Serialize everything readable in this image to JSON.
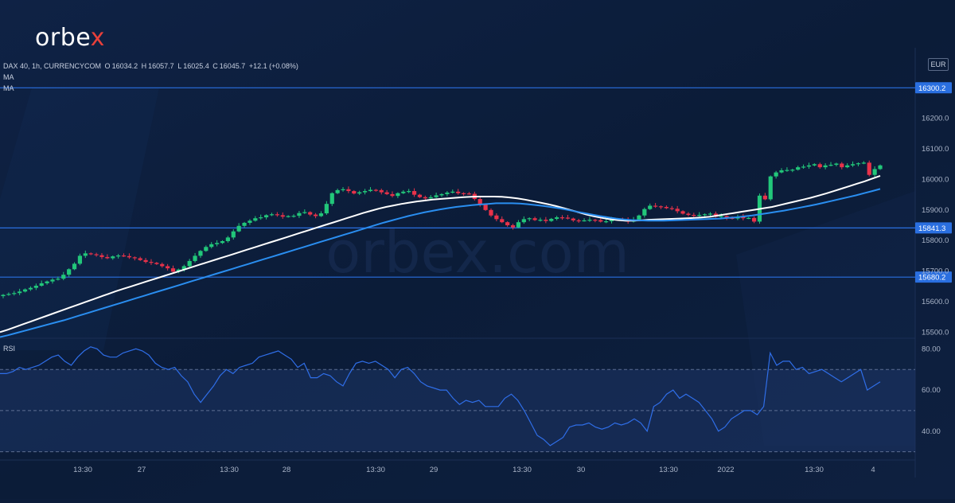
{
  "brand": {
    "logo_text": "orbe",
    "logo_accent": "x",
    "watermark": "orbex.com"
  },
  "header": {
    "symbol": "DAX 40, 1h, CURRENCYCOM",
    "open_label": "O",
    "open": "16034.2",
    "high_label": "H",
    "high": "16057.7",
    "low_label": "L",
    "low": "16025.4",
    "close_label": "C",
    "close": "16045.7",
    "change": "+12.1 (+0.08%)",
    "indicator_1": "MA",
    "indicator_2": "MA"
  },
  "axis": {
    "currency": "EUR"
  },
  "rsi": {
    "label": "RSI"
  },
  "colors": {
    "background": "#0c1d3a",
    "up": "#22c77a",
    "down": "#e8324a",
    "ma_fast": "#ffffff",
    "ma_slow": "#2a8ef0",
    "level": "#2a6fe0",
    "rsi_line": "#2f6ee8"
  },
  "chart_data": [
    {
      "type": "candlestick",
      "title": "DAX 40, 1h, CURRENCYCOM",
      "ylim": [
        15480,
        16400
      ],
      "y_ticks": [
        15500.0,
        15600.0,
        15700.0,
        15800.0,
        15900.0,
        16000.0,
        16100.0,
        16200.0
      ],
      "y_tick_labels": [
        "15500.0",
        "15600.0",
        "15700.0",
        "15800.0",
        "15900.0",
        "16000.0",
        "16100.0",
        "16200.0"
      ],
      "x_tick_labels": [
        "13:30",
        "27",
        "13:30",
        "28",
        "13:30",
        "29",
        "13:30",
        "30",
        "13:30",
        "2022",
        "13:30",
        "4"
      ],
      "levels": [
        16300.2,
        15841.3,
        15680.2
      ],
      "level_labels": [
        "16300.2",
        "15841.3",
        "15680.2"
      ],
      "close_values": [
        15622,
        15625,
        15628,
        15633,
        15640,
        15645,
        15652,
        15660,
        15666,
        15672,
        15675,
        15688,
        15706,
        15724,
        15750,
        15758,
        15755,
        15752,
        15746,
        15742,
        15748,
        15751,
        15749,
        15745,
        15742,
        15736,
        15730,
        15727,
        15723,
        15716,
        15709,
        15698,
        15705,
        15716,
        15733,
        15750,
        15766,
        15779,
        15788,
        15792,
        15798,
        15810,
        15830,
        15848,
        15858,
        15865,
        15873,
        15876,
        15883,
        15886,
        15883,
        15878,
        15880,
        15881,
        15890,
        15893,
        15885,
        15880,
        15889,
        15920,
        15955,
        15965,
        15968,
        15962,
        15954,
        15958,
        15962,
        15966,
        15965,
        15958,
        15952,
        15946,
        15955,
        15960,
        15962,
        15950,
        15942,
        15938,
        15942,
        15948,
        15952,
        15957,
        15960,
        15955,
        15954,
        15953,
        15936,
        15918,
        15900,
        15882,
        15870,
        15860,
        15850,
        15843,
        15860,
        15870,
        15873,
        15867,
        15868,
        15864,
        15871,
        15876,
        15875,
        15872,
        15866,
        15865,
        15866,
        15868,
        15867,
        15862,
        15863,
        15868,
        15870,
        15869,
        15862,
        15868,
        15882,
        15903,
        15914,
        15912,
        15910,
        15906,
        15904,
        15896,
        15888,
        15884,
        15881,
        15884,
        15886,
        15888,
        15878,
        15880,
        15874,
        15872,
        15878,
        15873,
        15874,
        15862,
        15947,
        15935,
        16010,
        16023,
        16030,
        16031,
        16032,
        16040,
        16042,
        16046,
        16050,
        16040,
        16046,
        16048,
        16052,
        16040,
        16046,
        16050,
        16053,
        16055,
        16015,
        16034,
        16046
      ],
      "series": [
        {
          "name": "MA",
          "values": [
            15500,
            15508,
            15517,
            15526,
            15535,
            15544,
            15553,
            15562,
            15571,
            15580,
            15589,
            15598,
            15607,
            15616,
            15625,
            15634,
            15642,
            15650,
            15658,
            15666,
            15674,
            15682,
            15690,
            15698,
            15706,
            15714,
            15722,
            15730,
            15738,
            15746,
            15754,
            15762,
            15770,
            15778,
            15786,
            15794,
            15802,
            15810,
            15818,
            15826,
            15834,
            15842,
            15850,
            15858,
            15866,
            15874,
            15882,
            15890,
            15897,
            15904,
            15910,
            15915,
            15920,
            15924,
            15928,
            15931,
            15934,
            15936,
            15938,
            15940,
            15942,
            15943,
            15944,
            15944,
            15944,
            15943,
            15941,
            15938,
            15934,
            15929,
            15924,
            15919,
            15913,
            15906,
            15899,
            15892,
            15885,
            15879,
            15874,
            15870,
            15867,
            15865,
            15865,
            15866,
            15868,
            15869,
            15870,
            15871,
            15872,
            15873,
            15874,
            15876,
            15878,
            15882,
            15886,
            15890,
            15894,
            15898,
            15902,
            15906,
            15910,
            15916,
            15922,
            15928,
            15934,
            15940,
            15947,
            15954,
            15962,
            15970,
            15978,
            15986,
            15994,
            16003,
            16012
          ]
        },
        {
          "name": "MA",
          "values": [
            15484,
            15490,
            15497,
            15504,
            15511,
            15518,
            15525,
            15532,
            15539,
            15547,
            15555,
            15563,
            15571,
            15579,
            15587,
            15595,
            15603,
            15611,
            15619,
            15627,
            15635,
            15643,
            15651,
            15659,
            15667,
            15675,
            15683,
            15691,
            15699,
            15707,
            15715,
            15723,
            15731,
            15739,
            15747,
            15755,
            15763,
            15771,
            15779,
            15787,
            15795,
            15803,
            15811,
            15819,
            15827,
            15835,
            15843,
            15851,
            15859,
            15866,
            15873,
            15880,
            15886,
            15892,
            15897,
            15902,
            15906,
            15910,
            15913,
            15916,
            15918,
            15920,
            15922,
            15922,
            15922,
            15921,
            15919,
            15916,
            15913,
            15909,
            15905,
            15900,
            15895,
            15890,
            15885,
            15880,
            15876,
            15872,
            15869,
            15867,
            15866,
            15865,
            15865,
            15865,
            15866,
            15867,
            15868,
            15869,
            15870,
            15871,
            15872,
            15874,
            15876,
            15879,
            15882,
            15886,
            15890,
            15894,
            15898,
            15903,
            15908,
            15913,
            15918,
            15924,
            15930,
            15936,
            15942,
            15948,
            15955,
            15962,
            15969
          ]
        }
      ]
    },
    {
      "type": "line",
      "title": "RSI",
      "ylim": [
        26,
        84
      ],
      "y_ticks": [
        40.0,
        60.0,
        80.0
      ],
      "y_tick_labels": [
        "40.00",
        "60.00",
        "80.00"
      ],
      "band": [
        30,
        70
      ],
      "midline": 50,
      "series": [
        {
          "name": "RSI",
          "values": [
            68,
            68,
            69,
            71,
            70,
            71,
            72,
            74,
            76,
            77,
            74,
            72,
            76,
            79,
            81,
            80,
            77,
            76,
            76,
            78,
            79,
            80,
            79,
            77,
            73,
            71,
            70,
            71,
            67,
            64,
            58,
            54,
            58,
            62,
            67,
            70,
            68,
            71,
            72,
            73,
            76,
            77,
            78,
            79,
            77,
            75,
            71,
            73,
            66,
            66,
            68,
            67,
            64,
            62,
            68,
            73,
            74,
            73,
            74,
            72,
            70,
            66,
            70,
            71,
            68,
            64,
            62,
            61,
            60,
            60,
            56,
            53,
            55,
            54,
            55,
            52,
            52,
            52,
            56,
            58,
            55,
            50,
            44,
            38,
            36,
            33,
            35,
            37,
            42,
            43,
            43,
            44,
            42,
            41,
            42,
            44,
            43,
            44,
            46,
            44,
            40,
            52,
            54,
            58,
            60,
            56,
            58,
            56,
            54,
            50,
            46,
            40,
            42,
            46,
            48,
            50,
            50,
            48,
            52,
            78,
            72,
            74,
            74,
            70,
            71,
            68,
            69,
            70,
            68,
            66,
            64,
            66,
            68,
            70,
            60,
            62,
            64
          ]
        }
      ]
    }
  ]
}
